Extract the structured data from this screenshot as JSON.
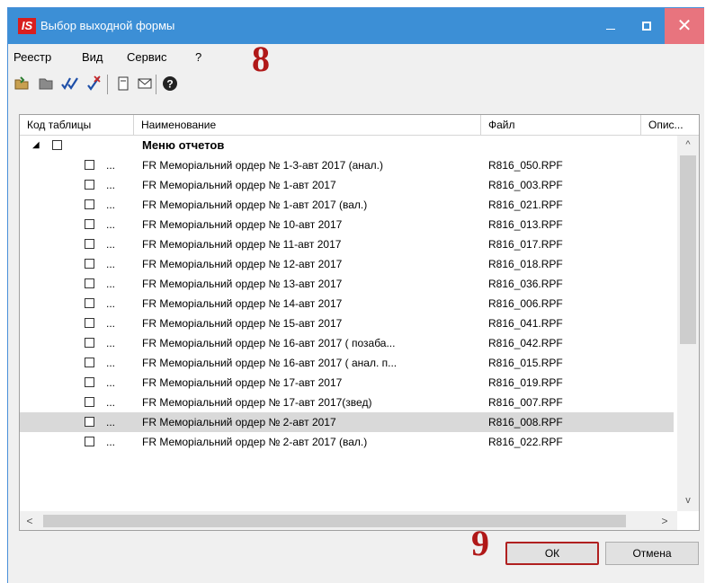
{
  "window": {
    "logo_text": "IS",
    "title": "Выбор выходной формы",
    "controls": {
      "minimize": "_",
      "close": "✕"
    }
  },
  "menu": [
    "Реестр",
    "Вид",
    "Сервис",
    "?"
  ],
  "toolbar": {
    "icons": [
      "folder-open-icon",
      "folder-icon",
      "check-all-icon",
      "uncheck-all-icon",
      "document-icon",
      "envelope-icon",
      "help-icon"
    ]
  },
  "annotations": {
    "a8": "8",
    "a9": "9"
  },
  "table": {
    "columns": [
      "Код таблицы",
      "Наименование",
      "Файл",
      "Опис..."
    ],
    "group": {
      "expander": "◢",
      "name": "Меню отчетов"
    },
    "ellipsis": "...",
    "rows": [
      {
        "name": "FR Меморіальний ордер № 1-3-авт 2017 (анал.)",
        "file": "R816_050.RPF"
      },
      {
        "name": "FR Меморіальний ордер № 1-авт 2017",
        "file": "R816_003.RPF"
      },
      {
        "name": "FR Меморіальний ордер № 1-авт 2017 (вал.)",
        "file": "R816_021.RPF"
      },
      {
        "name": "FR Меморіальний ордер № 10-авт 2017",
        "file": "R816_013.RPF"
      },
      {
        "name": "FR Меморіальний ордер № 11-авт 2017",
        "file": "R816_017.RPF"
      },
      {
        "name": "FR Меморіальний ордер № 12-авт 2017",
        "file": "R816_018.RPF"
      },
      {
        "name": "FR Меморіальний ордер № 13-авт 2017",
        "file": "R816_036.RPF"
      },
      {
        "name": "FR Меморіальний ордер № 14-авт 2017",
        "file": "R816_006.RPF"
      },
      {
        "name": "FR Меморіальний ордер № 15-авт 2017",
        "file": "R816_041.RPF"
      },
      {
        "name": "FR Меморіальний ордер № 16-авт 2017  ( позаба...",
        "file": "R816_042.RPF"
      },
      {
        "name": "FR Меморіальний ордер № 16-авт 2017 ( анал. п...",
        "file": "R816_015.RPF"
      },
      {
        "name": "FR Меморіальний ордер № 17-авт 2017",
        "file": "R816_019.RPF"
      },
      {
        "name": "FR Меморіальний ордер № 17-авт 2017(звед)",
        "file": "R816_007.RPF"
      },
      {
        "name": "FR Меморіальний ордер № 2-авт 2017",
        "file": "R816_008.RPF",
        "selected": true
      },
      {
        "name": "FR Меморіальний ордер № 2-авт 2017 (вал.)",
        "file": "R816_022.RPF"
      }
    ]
  },
  "scroll": {
    "up": "^",
    "down": "v",
    "left": "<",
    "right": ">"
  },
  "buttons": {
    "ok": "ОК",
    "cancel": "Отмена"
  }
}
